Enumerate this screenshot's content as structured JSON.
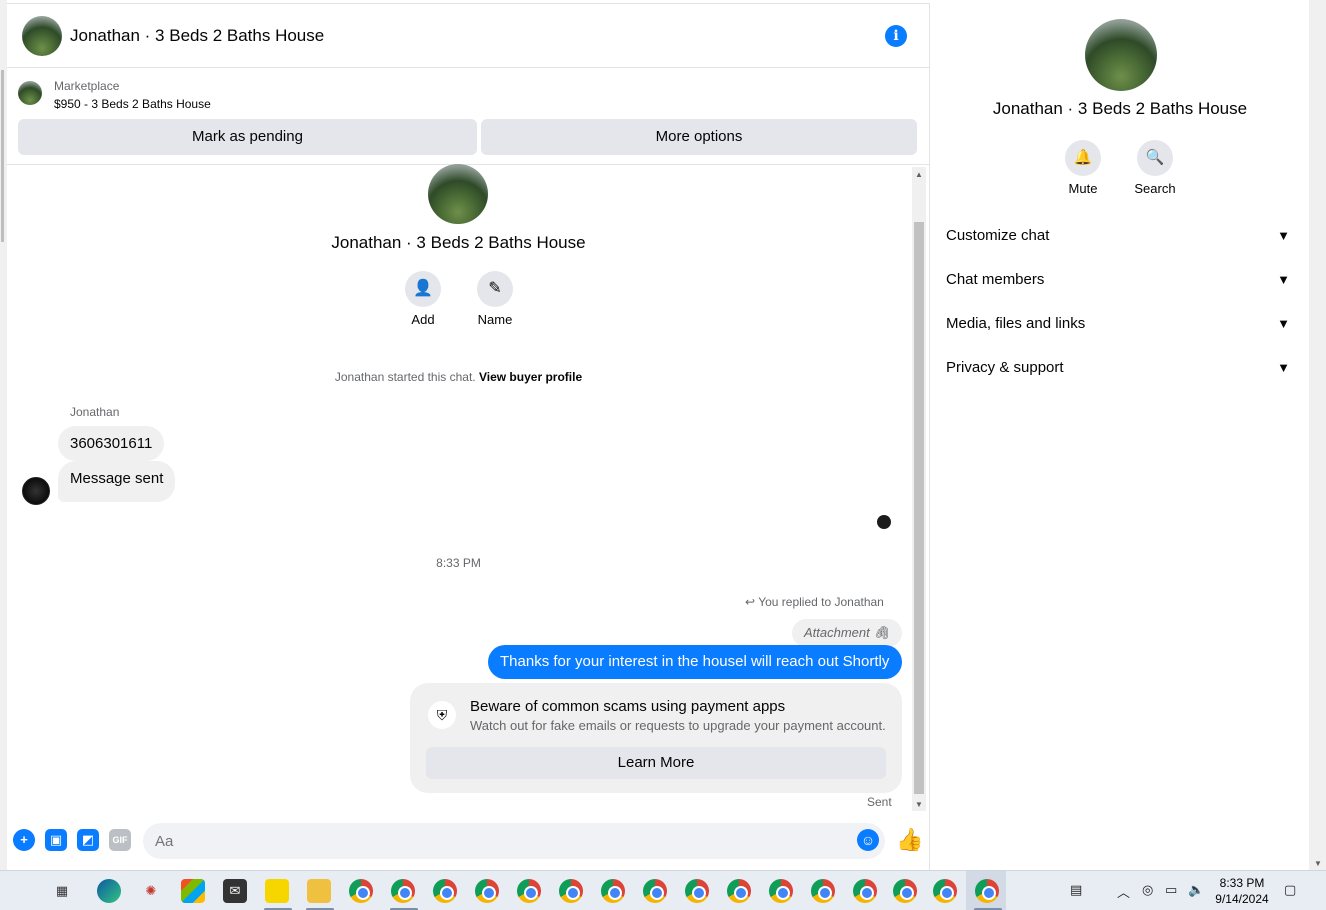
{
  "chat": {
    "title": "Jonathan · 3 Beds 2 Baths House",
    "info_icon": "info-icon",
    "listing": {
      "label": "Marketplace",
      "price_title": "$950 - 3 Beds 2 Baths House",
      "pending_label": "Mark as pending",
      "more_label": "More options"
    },
    "intro": {
      "title": "Jonathan · 3 Beds 2 Baths House",
      "add_label": "Add",
      "name_label": "Name",
      "started_text": "Jonathan started this chat.",
      "buyer_profile_link": "View buyer profile"
    },
    "messages": {
      "sender": "Jonathan",
      "incoming": [
        "3606301611",
        "Message sent"
      ],
      "timestamp": "8:33 PM",
      "replied_label": "You replied to Jonathan",
      "attachment_label": "Attachment",
      "outgoing": "Thanks for your interest in the housel will reach out Shortly",
      "sent_label": "Sent"
    },
    "scam_card": {
      "title": "Beware of common scams using payment apps",
      "subtitle": "Watch out for fake emails or requests to upgrade your payment account.",
      "button": "Learn More"
    },
    "composer": {
      "placeholder": "Aa",
      "gif_label": "GIF"
    },
    "accent_color": "#0a7cff"
  },
  "right_panel": {
    "title": "Jonathan · 3 Beds 2 Baths House",
    "mute_label": "Mute",
    "search_label": "Search",
    "sections": [
      "Customize chat",
      "Chat members",
      "Media, files and links",
      "Privacy & support"
    ]
  },
  "taskbar": {
    "time": "8:33 PM",
    "date": "9/14/2024"
  }
}
